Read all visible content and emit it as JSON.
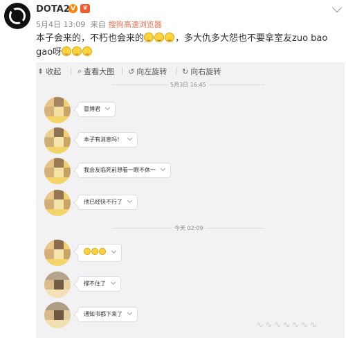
{
  "post": {
    "account_name": "DOTA2",
    "verified_icon": "verified-badge-icon",
    "vip_icon": "vip-crown-icon",
    "date": "5月4日 13:09",
    "source_prefix": "来自",
    "source": "搜狗高速浏览器",
    "text_part1": "本子会来的，不朽也会来的",
    "text_part2": "，多大仇多大怨也不要拿室友zuo bao gao呀"
  },
  "toolbar": {
    "collapse": "收起",
    "view_full": "查看大图",
    "rotate_left": "向左旋转",
    "rotate_right": "向右旋转"
  },
  "chat": {
    "timestamp1": "5月3日 16:45",
    "timestamp2": "今天 02:09",
    "messages": [
      {
        "text": "冒博君"
      },
      {
        "text": "本子有消息吗！"
      },
      {
        "text": "我会友临死前想看一眼不休一"
      },
      {
        "text": "他已经快不行了"
      },
      {
        "text": ""
      },
      {
        "text": "撑不住了"
      },
      {
        "text": "通知书都下来了"
      }
    ]
  },
  "colors": {
    "accent_orange": "#eb7350",
    "panel_bg": "#f2f2f5",
    "verified": "#ff8200"
  }
}
